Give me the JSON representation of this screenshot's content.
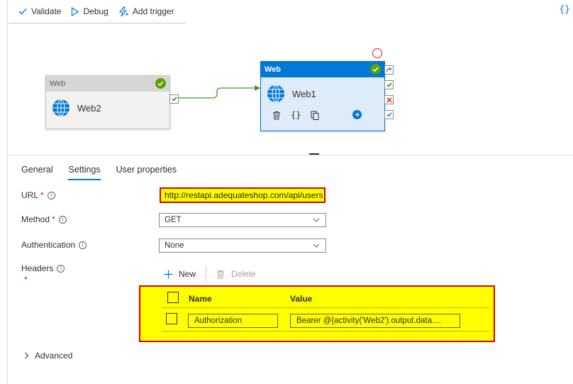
{
  "toolbar": {
    "validate_label": "Validate",
    "debug_label": "Debug",
    "add_trigger_label": "Add trigger",
    "code_icon_text": "{}"
  },
  "canvas": {
    "node_web2": {
      "type_label": "Web",
      "name": "Web2"
    },
    "node_web1": {
      "type_label": "Web",
      "name": "Web1",
      "code_action": "{}"
    }
  },
  "tabs": [
    {
      "label": "General"
    },
    {
      "label": "Settings"
    },
    {
      "label": "User properties"
    }
  ],
  "form": {
    "url_label": "URL",
    "url_value": "http://restapi.adequateshop.com/api/users",
    "method_label": "Method",
    "method_value": "GET",
    "auth_label": "Authentication",
    "auth_value": "None",
    "headers_label": "Headers",
    "required_mark": "*",
    "info_glyph": "i",
    "new_label": "New",
    "delete_label": "Delete",
    "headers_table": {
      "col_name": "Name",
      "col_value": "Value",
      "rows": [
        {
          "name": "Authorization",
          "value": "Bearer @{activity('Web2').output.data...."
        }
      ]
    },
    "advanced_label": "Advanced"
  },
  "colors": {
    "accent": "#0078d4",
    "success": "#57a300",
    "highlight": "#ffff00",
    "highlight_border": "#e00000"
  }
}
